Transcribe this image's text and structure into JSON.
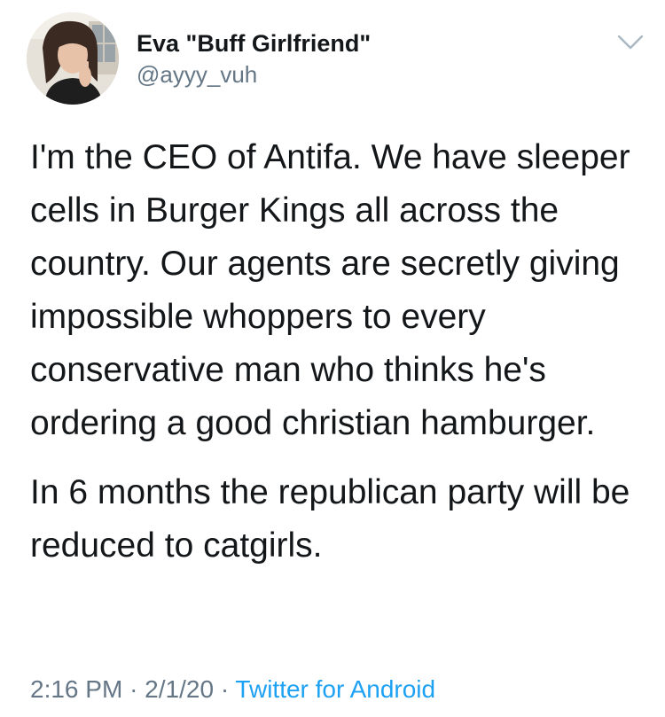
{
  "tweet": {
    "display_name": "Eva \"Buff Girlfriend\"",
    "handle": "@ayyy_vuh",
    "paragraphs": [
      "I'm the CEO of Antifa. We have sleeper cells in Burger Kings all across the country. Our agents are secretly giving impossible whoppers to every conservative man who thinks he's ordering a good christian hamburger.",
      "In 6 months the republican party will be reduced to catgirls."
    ],
    "time": "2:16 PM",
    "separator": "·",
    "date": "2/1/20",
    "source": "Twitter for Android"
  },
  "colors": {
    "text": "#14171a",
    "secondary": "#657786",
    "link": "#1da1f2"
  },
  "icons": {
    "menu": "chevron-down-icon"
  }
}
